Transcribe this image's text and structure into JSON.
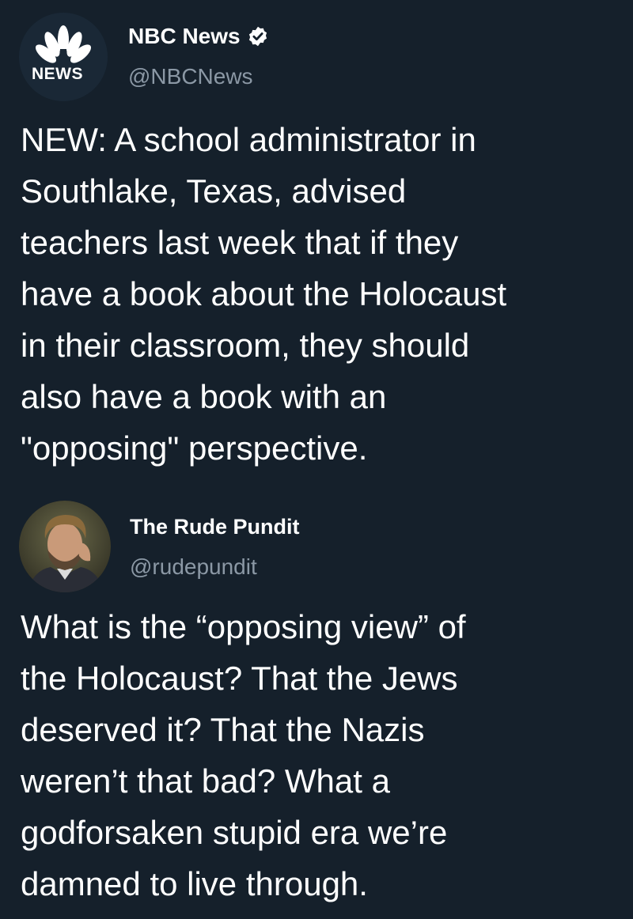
{
  "tweets": [
    {
      "author_name": "NBC News",
      "handle": "@NBCNews",
      "verified": true,
      "avatar": {
        "icon": "nbc-peacock-logo",
        "logo_text": "NEWS"
      },
      "text": "NEW: A school administrator in\nSouthlake, Texas, advised\nteachers last week that if they\nhave a book about the Holocaust\nin their classroom, they should\nalso have a book with an\n\"opposing\" perspective."
    },
    {
      "author_name": "The Rude Pundit",
      "handle": "@rudepundit",
      "verified": false,
      "avatar": {
        "icon": "profile-photo"
      },
      "text": "What is the “opposing view” of\nthe Holocaust? That the Jews\ndeserved it? That the Nazis\nweren’t that bad? What a\ngodforsaken stupid era we’re\ndamned to live through."
    }
  ],
  "colors": {
    "background": "#15202b",
    "primary_text": "#ffffff",
    "secondary_text": "#8b98a5",
    "verified_badge": "#ffffff"
  }
}
